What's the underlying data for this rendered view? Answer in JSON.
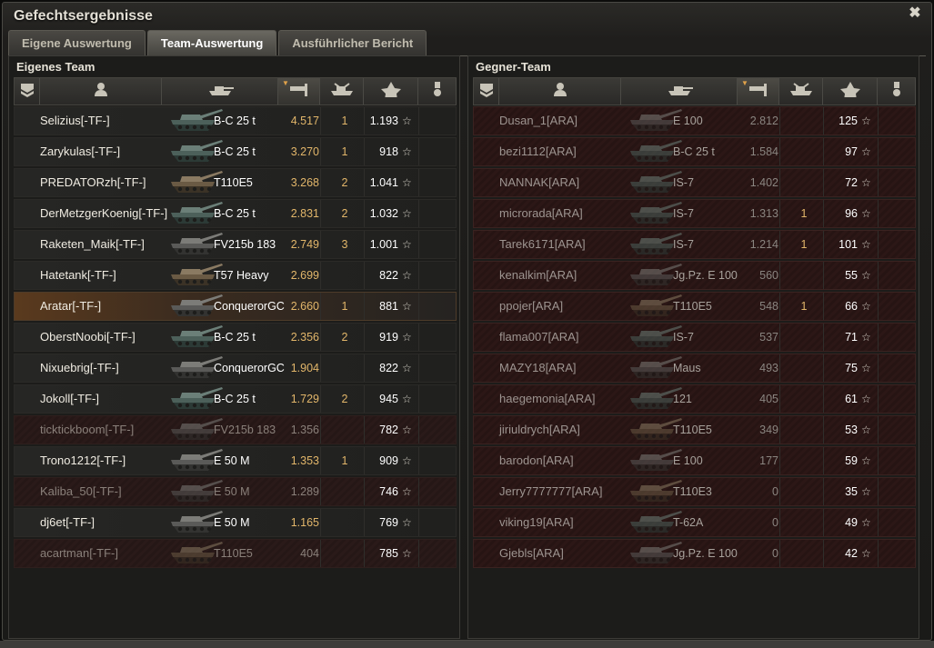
{
  "window": {
    "title": "Gefechtsergebnisse"
  },
  "tabs": [
    {
      "label": "Eigene Auswertung",
      "active": false
    },
    {
      "label": "Team-Auswertung",
      "active": true
    },
    {
      "label": "Ausführlicher Bericht",
      "active": false
    }
  ],
  "colors": {
    "accent": "#e2b66a",
    "own_row": "#262624",
    "enemy_row": "#3a1c1a",
    "self_row": "#5a3a1e",
    "dead_row": "#2a1a19"
  },
  "header_icons": [
    "rank-icon",
    "player-icon",
    "tank-icon",
    "damage-icon",
    "kills-icon",
    "xp-star-icon",
    "medal-icon"
  ],
  "own_team": {
    "title": "Eigenes Team",
    "players": [
      {
        "name": "Selizius[-TF-]",
        "tank": "B-C 25 t",
        "damage": "4.517",
        "kills": "1",
        "xp": "1.193",
        "status": "alive",
        "tank_tone": "green"
      },
      {
        "name": "Zarykulas[-TF-]",
        "tank": "B-C 25 t",
        "damage": "3.270",
        "kills": "1",
        "xp": "918",
        "status": "alive",
        "tank_tone": "green"
      },
      {
        "name": "PREDATORzh[-TF-]",
        "tank": "T110E5",
        "damage": "3.268",
        "kills": "2",
        "xp": "1.041",
        "status": "alive",
        "tank_tone": "tan"
      },
      {
        "name": "DerMetzgerKoenig[-TF-]",
        "tank": "B-C 25 t",
        "damage": "2.831",
        "kills": "2",
        "xp": "1.032",
        "status": "alive",
        "tank_tone": "green"
      },
      {
        "name": "Raketen_Maik[-TF-]",
        "tank": "FV215b 183",
        "damage": "2.749",
        "kills": "3",
        "xp": "1.001",
        "status": "alive",
        "tank_tone": "grey"
      },
      {
        "name": "Hatetank[-TF-]",
        "tank": "T57 Heavy",
        "damage": "2.699",
        "kills": "",
        "xp": "822",
        "status": "alive",
        "tank_tone": "tan"
      },
      {
        "name": "Aratar[-TF-]",
        "tank": "ConquerorGC",
        "damage": "2.660",
        "kills": "1",
        "xp": "881",
        "status": "self",
        "tank_tone": "grey"
      },
      {
        "name": "OberstNoobi[-TF-]",
        "tank": "B-C 25 t",
        "damage": "2.356",
        "kills": "2",
        "xp": "919",
        "status": "alive",
        "tank_tone": "green"
      },
      {
        "name": "Nixuebrig[-TF-]",
        "tank": "ConquerorGC",
        "damage": "1.904",
        "kills": "",
        "xp": "822",
        "status": "alive",
        "tank_tone": "grey"
      },
      {
        "name": "Jokoll[-TF-]",
        "tank": "B-C 25 t",
        "damage": "1.729",
        "kills": "2",
        "xp": "945",
        "status": "alive",
        "tank_tone": "green"
      },
      {
        "name": "ticktickboom[-TF-]",
        "tank": "FV215b 183",
        "damage": "1.356",
        "kills": "",
        "xp": "782",
        "status": "dead",
        "tank_tone": "grey"
      },
      {
        "name": "Trono1212[-TF-]",
        "tank": "E 50 M",
        "damage": "1.353",
        "kills": "1",
        "xp": "909",
        "status": "alive",
        "tank_tone": "grey"
      },
      {
        "name": "Kaliba_50[-TF-]",
        "tank": "E 50 M",
        "damage": "1.289",
        "kills": "",
        "xp": "746",
        "status": "dead",
        "tank_tone": "grey"
      },
      {
        "name": "dj6et[-TF-]",
        "tank": "E 50 M",
        "damage": "1.165",
        "kills": "",
        "xp": "769",
        "status": "alive",
        "tank_tone": "grey"
      },
      {
        "name": "acartman[-TF-]",
        "tank": "T110E5",
        "damage": "404",
        "kills": "",
        "xp": "785",
        "status": "dead",
        "tank_tone": "tan"
      }
    ]
  },
  "enemy_team": {
    "title": "Gegner-Team",
    "players": [
      {
        "name": "Dusan_1[ARA]",
        "tank": "E 100",
        "damage": "2.812",
        "kills": "",
        "xp": "125",
        "status": "dead",
        "tank_tone": "grey"
      },
      {
        "name": "bezi1112[ARA]",
        "tank": "B-C 25 t",
        "damage": "1.584",
        "kills": "",
        "xp": "97",
        "status": "dead",
        "tank_tone": "green"
      },
      {
        "name": "NANNAK[ARA]",
        "tank": "IS-7",
        "damage": "1.402",
        "kills": "",
        "xp": "72",
        "status": "dead",
        "tank_tone": "green"
      },
      {
        "name": "microrada[ARA]",
        "tank": "IS-7",
        "damage": "1.313",
        "kills": "1",
        "xp": "96",
        "status": "dead",
        "tank_tone": "green"
      },
      {
        "name": "Tarek6171[ARA]",
        "tank": "IS-7",
        "damage": "1.214",
        "kills": "1",
        "xp": "101",
        "status": "dead",
        "tank_tone": "green"
      },
      {
        "name": "kenalkim[ARA]",
        "tank": "Jg.Pz. E 100",
        "damage": "560",
        "kills": "",
        "xp": "55",
        "status": "dead",
        "tank_tone": "grey"
      },
      {
        "name": "ppojer[ARA]",
        "tank": "T110E5",
        "damage": "548",
        "kills": "1",
        "xp": "66",
        "status": "dead",
        "tank_tone": "tan"
      },
      {
        "name": "flama007[ARA]",
        "tank": "IS-7",
        "damage": "537",
        "kills": "",
        "xp": "71",
        "status": "dead",
        "tank_tone": "green"
      },
      {
        "name": "MAZY18[ARA]",
        "tank": "Maus",
        "damage": "493",
        "kills": "",
        "xp": "75",
        "status": "dead",
        "tank_tone": "grey"
      },
      {
        "name": "haegemonia[ARA]",
        "tank": "121",
        "damage": "405",
        "kills": "",
        "xp": "61",
        "status": "dead",
        "tank_tone": "green"
      },
      {
        "name": "jiriuldrych[ARA]",
        "tank": "T110E5",
        "damage": "349",
        "kills": "",
        "xp": "53",
        "status": "dead",
        "tank_tone": "tan"
      },
      {
        "name": "barodon[ARA]",
        "tank": "E 100",
        "damage": "177",
        "kills": "",
        "xp": "59",
        "status": "dead",
        "tank_tone": "grey"
      },
      {
        "name": "Jerry7777777[ARA]",
        "tank": "T110E3",
        "damage": "0",
        "kills": "",
        "xp": "35",
        "status": "dead",
        "tank_tone": "tan"
      },
      {
        "name": "viking19[ARA]",
        "tank": "T-62A",
        "damage": "0",
        "kills": "",
        "xp": "49",
        "status": "dead",
        "tank_tone": "green"
      },
      {
        "name": "Gjebls[ARA]",
        "tank": "Jg.Pz. E 100",
        "damage": "0",
        "kills": "",
        "xp": "42",
        "status": "dead",
        "tank_tone": "grey"
      }
    ]
  }
}
